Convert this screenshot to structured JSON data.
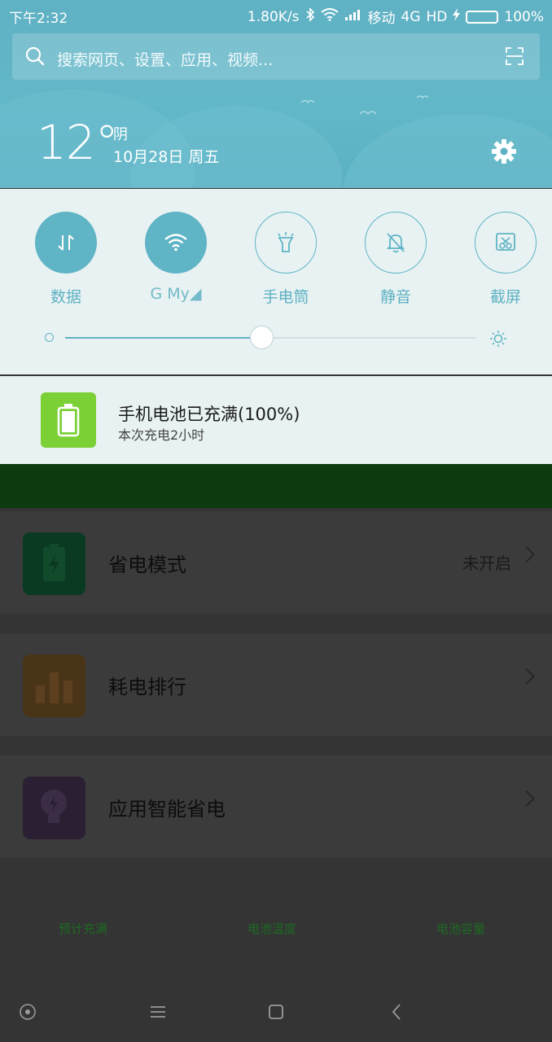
{
  "status_bar": {
    "time": "下午2:32",
    "net_speed": "1.80K/s",
    "carrier": "移动",
    "network": "4G",
    "hd": "HD",
    "battery_percent": "100%",
    "battery_level": 1.0
  },
  "search": {
    "placeholder": "搜索网页、设置、应用、视频..."
  },
  "weather": {
    "temperature": "12°",
    "condition": "阴",
    "date": "10月28日 周五"
  },
  "quick_settings": {
    "toggles": [
      {
        "label": "数据",
        "icon": "data-arrows-icon",
        "state": "on"
      },
      {
        "label": "G     My◢",
        "icon": "wifi-icon",
        "state": "on"
      },
      {
        "label": "手电筒",
        "icon": "flashlight-icon",
        "state": "off"
      },
      {
        "label": "静音",
        "icon": "mute-bell-icon",
        "state": "off"
      },
      {
        "label": "截屏",
        "icon": "screenshot-icon",
        "state": "off"
      }
    ],
    "brightness": 0.48
  },
  "notification": {
    "title": "手机电池已充满(100%)",
    "subtitle": "本次充电2小时",
    "icon": "battery-icon",
    "icon_color": "#7bd036"
  },
  "background_app": {
    "stats": [
      "预计充满",
      "电池温度",
      "电池容量"
    ],
    "rows": [
      {
        "label": "省电模式",
        "value": "未开启",
        "icon": "battery-save-icon",
        "icon_color": "#0a3a22"
      },
      {
        "label": "耗电排行",
        "value": "",
        "icon": "bar-chart-icon",
        "icon_color": "#4a3418"
      },
      {
        "label": "应用智能省电",
        "value": "",
        "icon": "lightbulb-icon",
        "icon_color": "#2a1f33"
      }
    ]
  },
  "accent_color": "#5fb4c5"
}
